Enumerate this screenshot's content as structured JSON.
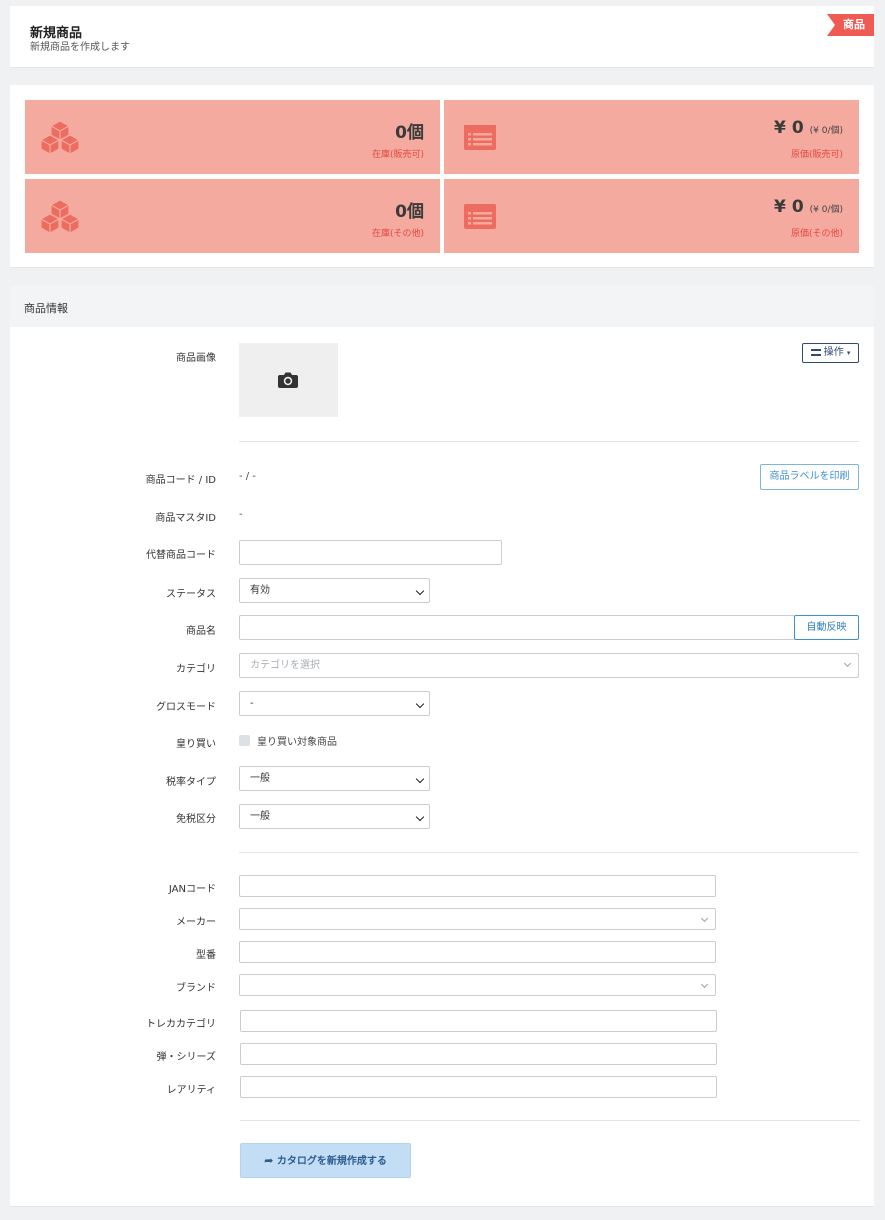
{
  "header": {
    "title": "新規商品",
    "subtitle": "新規商品を作成します",
    "badge": "商品"
  },
  "stats": [
    {
      "icon": "cubes-icon",
      "value": "0",
      "unit": "個",
      "caption": "在庫(販売可)"
    },
    {
      "icon": "list-icon",
      "currency": "¥",
      "value": "0",
      "sub": "(¥ 0/個)",
      "caption": "原価(販売可)"
    },
    {
      "icon": "cubes-icon",
      "value": "0",
      "unit": "個",
      "caption": "在庫(その他)"
    },
    {
      "icon": "list-icon",
      "currency": "¥",
      "value": "0",
      "sub": "(¥ 0/個)",
      "caption": "原価(その他)"
    }
  ],
  "section": {
    "title": "商品情報"
  },
  "form": {
    "image_label": "商品画像",
    "operations_label": "操作",
    "code_label": "商品コード / ID",
    "code_value": "- / -",
    "print_label_button": "商品ラベルを印刷",
    "master_id_label": "商品マスタID",
    "master_id_value": "-",
    "alt_code_label": "代替商品コード",
    "alt_code_value": "",
    "status_label": "ステータス",
    "status_value": "有効",
    "name_label": "商品名",
    "name_value": "",
    "auto_fill_button": "自動反映",
    "category_label": "カテゴリ",
    "category_placeholder": "カテゴリを選択",
    "gross_mode_label": "グロスモード",
    "gross_mode_value": "-",
    "buyback_label": "皇り買い",
    "buyback_option": "皇り買い対象商品",
    "tax_type_label": "税率タイプ",
    "tax_type_value": "一般",
    "duty_free_label": "免税区分",
    "duty_free_value": "一般",
    "jan_label": "JANコード",
    "maker_label": "メーカー",
    "model_label": "型番",
    "brand_label": "ブランド",
    "tcg_category_label": "トレカカテゴリ",
    "series_label": "弾・シリーズ",
    "rarity_label": "レアリティ",
    "create_catalog_button": "カタログを新規作成する"
  }
}
